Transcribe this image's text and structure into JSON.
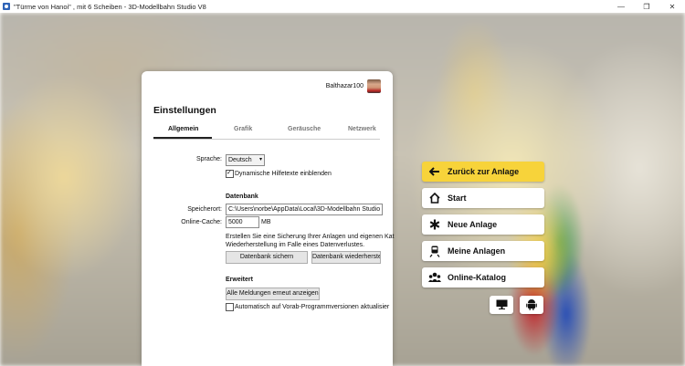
{
  "window": {
    "title": "\"Türme von Hanoi\" , mit 6 Scheiben - 3D-Modellbahn Studio V8",
    "minimize": "—",
    "maximize": "❐",
    "close": "✕"
  },
  "dialog": {
    "username": "Balthazar100",
    "title": "Einstellungen",
    "tabs": [
      "Allgemein",
      "Grafik",
      "Geräusche",
      "Netzwerk"
    ],
    "active_tab": "Allgemein",
    "general": {
      "language_label": "Sprache:",
      "language_value": "Deutsch",
      "dynamic_help_checked": true,
      "dynamic_help_label": "Dynamische Hilfetexte einblenden"
    },
    "database": {
      "heading": "Datenbank",
      "location_label": "Speicherort:",
      "location_value": "C:\\Users\\norbe\\AppData\\Local\\3D-Modellbahn Studio V8",
      "cache_label": "Online-Cache:",
      "cache_value": "5000",
      "cache_unit": "MB",
      "backup_text_1": "Erstellen Sie eine Sicherung Ihrer Anlagen und eigenen Kat",
      "backup_text_2": "Wiederherstellung im Falle eines Datenverlustes.",
      "backup_button": "Datenbank sichern",
      "restore_button": "Datenbank wiederherstel"
    },
    "advanced": {
      "heading": "Erweitert",
      "show_messages_button": "Alle Meldungen erneut anzeigen",
      "auto_update_checked": false,
      "auto_update_label": "Automatisch auf Vorab-Programmversionen aktualisier"
    }
  },
  "side_menu": {
    "items": [
      {
        "label": "Zurück zur Anlage",
        "icon": "arrow-left-icon",
        "primary": true
      },
      {
        "label": "Start",
        "icon": "home-icon",
        "primary": false
      },
      {
        "label": "Neue Anlage",
        "icon": "asterisk-icon",
        "primary": false
      },
      {
        "label": "Meine Anlagen",
        "icon": "train-icon",
        "primary": false
      },
      {
        "label": "Online-Katalog",
        "icon": "people-icon",
        "primary": false
      }
    ],
    "bottom_icons": [
      "monitor-icon",
      "android-icon"
    ]
  },
  "colors": {
    "primary_button": "#f7d33a"
  }
}
